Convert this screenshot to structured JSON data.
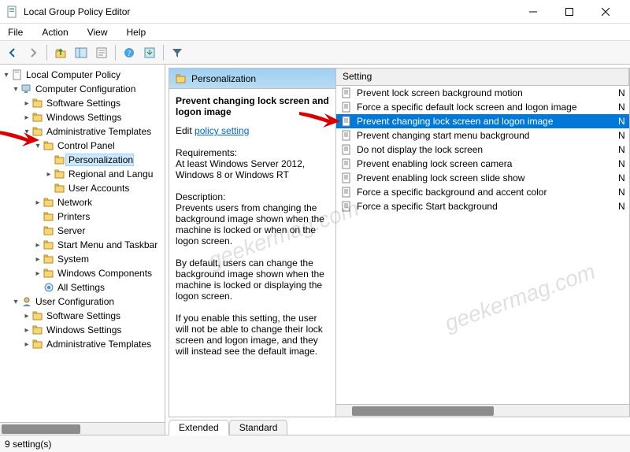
{
  "window": {
    "title": "Local Group Policy Editor"
  },
  "menubar": [
    "File",
    "Action",
    "View",
    "Help"
  ],
  "tree": {
    "root": "Local Computer Policy",
    "computer_config": "Computer Configuration",
    "cc_children": {
      "software": "Software Settings",
      "windows": "Windows Settings",
      "admin": "Administrative Templates",
      "control_panel": "Control Panel",
      "cp_children": {
        "personalization": "Personalization",
        "regional": "Regional and Langu",
        "user_accounts": "User Accounts"
      },
      "network": "Network",
      "printers": "Printers",
      "server": "Server",
      "start_menu": "Start Menu and Taskbar",
      "system": "System",
      "windows_components": "Windows Components",
      "all_settings": "All Settings"
    },
    "user_config": "User Configuration",
    "uc_children": {
      "software": "Software Settings",
      "windows": "Windows Settings",
      "admin": "Administrative Templates"
    }
  },
  "description": {
    "header": "Personalization",
    "policy_title": "Prevent changing lock screen and logon image",
    "edit_prefix": "Edit ",
    "edit_link": "policy setting",
    "requirements_label": "Requirements:",
    "requirements_text": "At least Windows Server 2012, Windows 8 or Windows RT",
    "description_label": "Description:",
    "desc1": "Prevents users from changing the background image shown when the machine is locked or when on the logon screen.",
    "desc2": "By default, users can change the background image shown when the machine is locked or displaying the logon screen.",
    "desc3": "If you enable this setting, the user will not be able to change their lock screen and logon image, and they will instead see the default image."
  },
  "settings": {
    "header_setting": "Setting",
    "header_state_abbrev": "N",
    "items": [
      {
        "label": "Prevent lock screen background motion",
        "state": "N",
        "selected": false
      },
      {
        "label": "Force a specific default lock screen and logon image",
        "state": "N",
        "selected": false
      },
      {
        "label": "Prevent changing lock screen and logon image",
        "state": "N",
        "selected": true
      },
      {
        "label": "Prevent changing start menu background",
        "state": "N",
        "selected": false
      },
      {
        "label": "Do not display the lock screen",
        "state": "N",
        "selected": false
      },
      {
        "label": "Prevent enabling lock screen camera",
        "state": "N",
        "selected": false
      },
      {
        "label": "Prevent enabling lock screen slide show",
        "state": "N",
        "selected": false
      },
      {
        "label": "Force a specific background and accent color",
        "state": "N",
        "selected": false
      },
      {
        "label": "Force a specific Start background",
        "state": "N",
        "selected": false
      }
    ]
  },
  "tabs": {
    "extended": "Extended",
    "standard": "Standard"
  },
  "statusbar": "9 setting(s)",
  "watermark": "geekermag.com"
}
